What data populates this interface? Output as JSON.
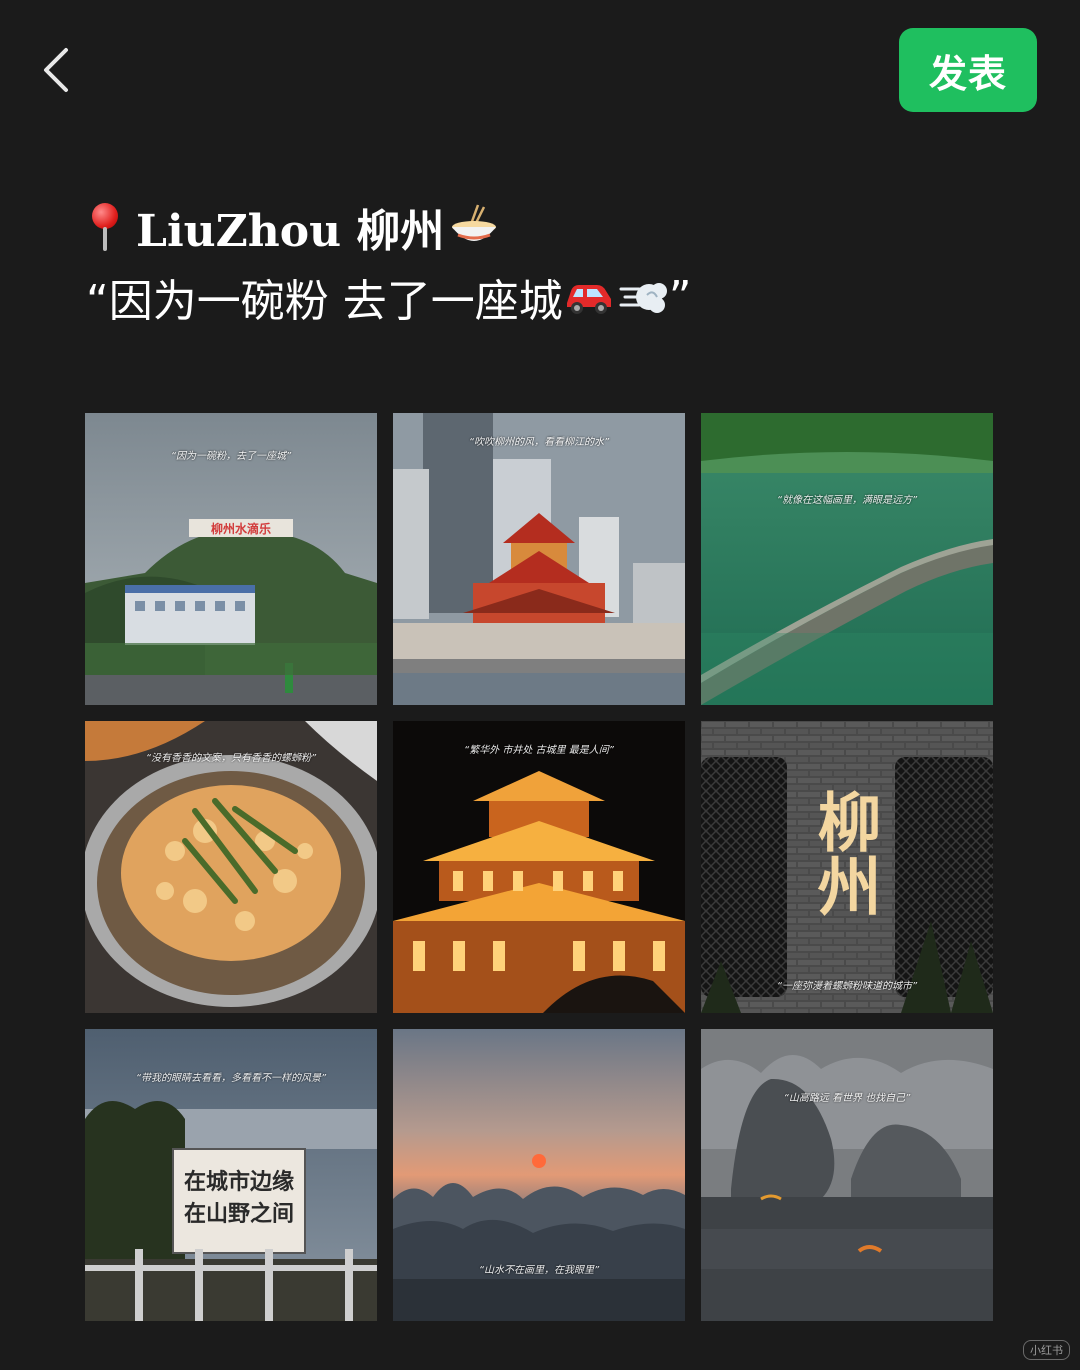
{
  "header": {
    "back_label": "back",
    "publish_label": "发表",
    "accent": "#1fbf5f"
  },
  "post": {
    "line1": "LiuZhou 柳州",
    "line2": "“因为一碗粉 去了一座城",
    "line2_end": "”",
    "icons": [
      "location-pin-icon",
      "noodle-bowl-icon",
      "red-car-icon",
      "dash-cloud-icon"
    ]
  },
  "images": [
    {
      "caption": "“因为一碗粉，去了一座城”",
      "sign": "柳州水滴乐"
    },
    {
      "caption": "“吹吹柳州的风，看看柳江的水”"
    },
    {
      "caption": "“就像在这幅画里，满眼是远方”"
    },
    {
      "caption": "“没有香香的文案，只有香香的螺蛳粉”"
    },
    {
      "caption": "“繁华外 市井处 古城里 最是人间”"
    },
    {
      "caption": "“一座弥漫着螺蛳粉味道的城市”",
      "sign": "柳州"
    },
    {
      "caption": "“带我的眼睛去看看，多看看不一样的风景”",
      "sign1": "在城市边缘",
      "sign2": "在山野之间"
    },
    {
      "caption": "“山水不在画里，在我眼里”"
    },
    {
      "caption": "“山高路远 看世界 也找自己”"
    }
  ],
  "watermark": "小红书"
}
